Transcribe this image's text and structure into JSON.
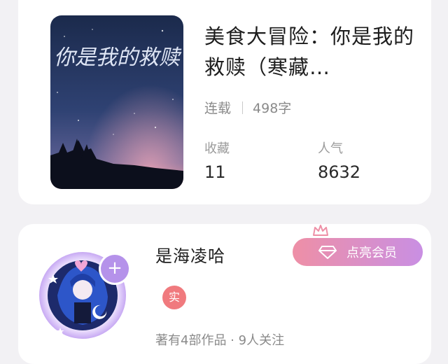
{
  "book": {
    "title": "美食大冒险：你是我的救赎（寒藏…",
    "status": "连载",
    "word_count": "498字",
    "cover_title": "你是我的救赎",
    "stats": [
      {
        "label": "收藏",
        "value": "11"
      },
      {
        "label": "人气",
        "value": "8632"
      }
    ]
  },
  "author": {
    "name": "是海凌哈",
    "badge": "实",
    "summary": "著有4部作品 · 9人关注",
    "follow_symbol": "+",
    "vip_label": "点亮会员"
  },
  "colors": {
    "vip_gradient_start": "#ee8fa6",
    "vip_gradient_end": "#c98fe3",
    "badge": "#f07a7e",
    "plus": "#b592ea"
  }
}
